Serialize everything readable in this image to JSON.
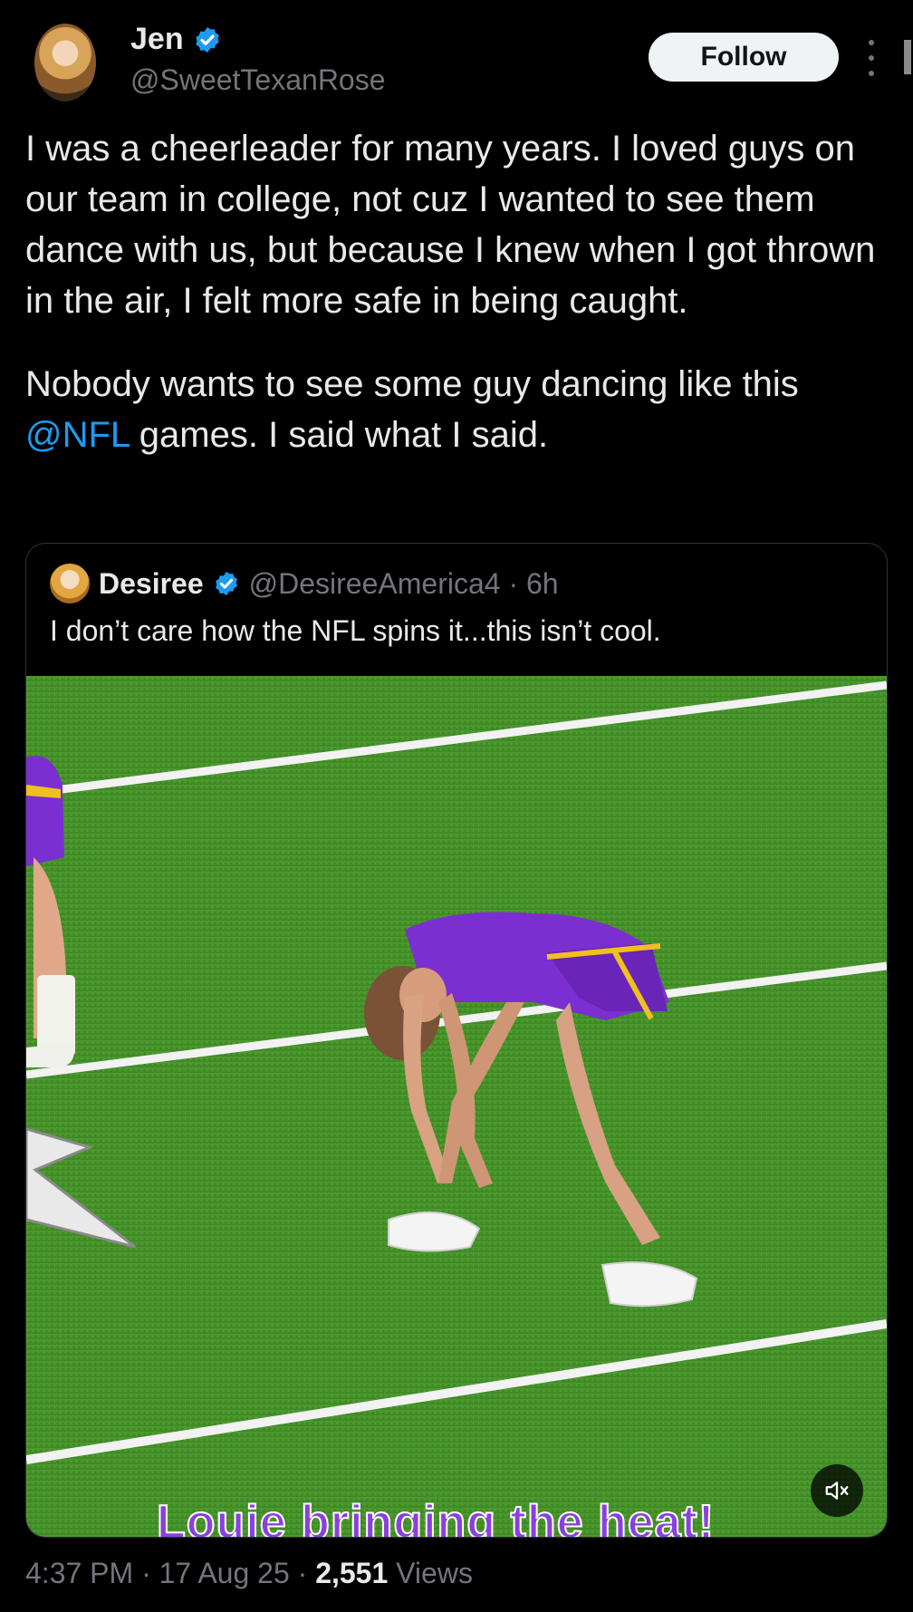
{
  "author": {
    "name": "Jen",
    "handle": "@SweetTexanRose",
    "verified": true,
    "avatar_icon": "profile-photo"
  },
  "actions": {
    "follow_label": "Follow",
    "more_icon": "more-vertical-icon"
  },
  "tweet": {
    "paragraph1": "I was a cheerleader for many years. I loved guys on our team in college, not cuz I wanted to see them dance with us, but because I knew when I got thrown in the air, I felt more safe in being caught.",
    "paragraph2_start": "Nobody wants to see some guy dancing like this ",
    "mention": "@NFL",
    "paragraph2_end": " games. I said what I said."
  },
  "quoted": {
    "name": "Desiree",
    "handle": "@DesireeAmerica4",
    "separator": " · ",
    "time": "6h",
    "text": "I don’t care how the NFL spins it...this isn’t cool.",
    "video": {
      "caption": "Louie bringing the heat!",
      "mute_icon": "volume-muted-icon"
    }
  },
  "meta": {
    "time": "4:37 PM",
    "date": "17 Aug 25",
    "views_count": "2,551",
    "views_label": "Views"
  },
  "colors": {
    "background": "#000000",
    "text": "#e7e9ea",
    "secondary": "#71767b",
    "accent": "#1d9bf0",
    "field_green": "#4e9a2f",
    "uniform_purple": "#7b2fd0"
  }
}
